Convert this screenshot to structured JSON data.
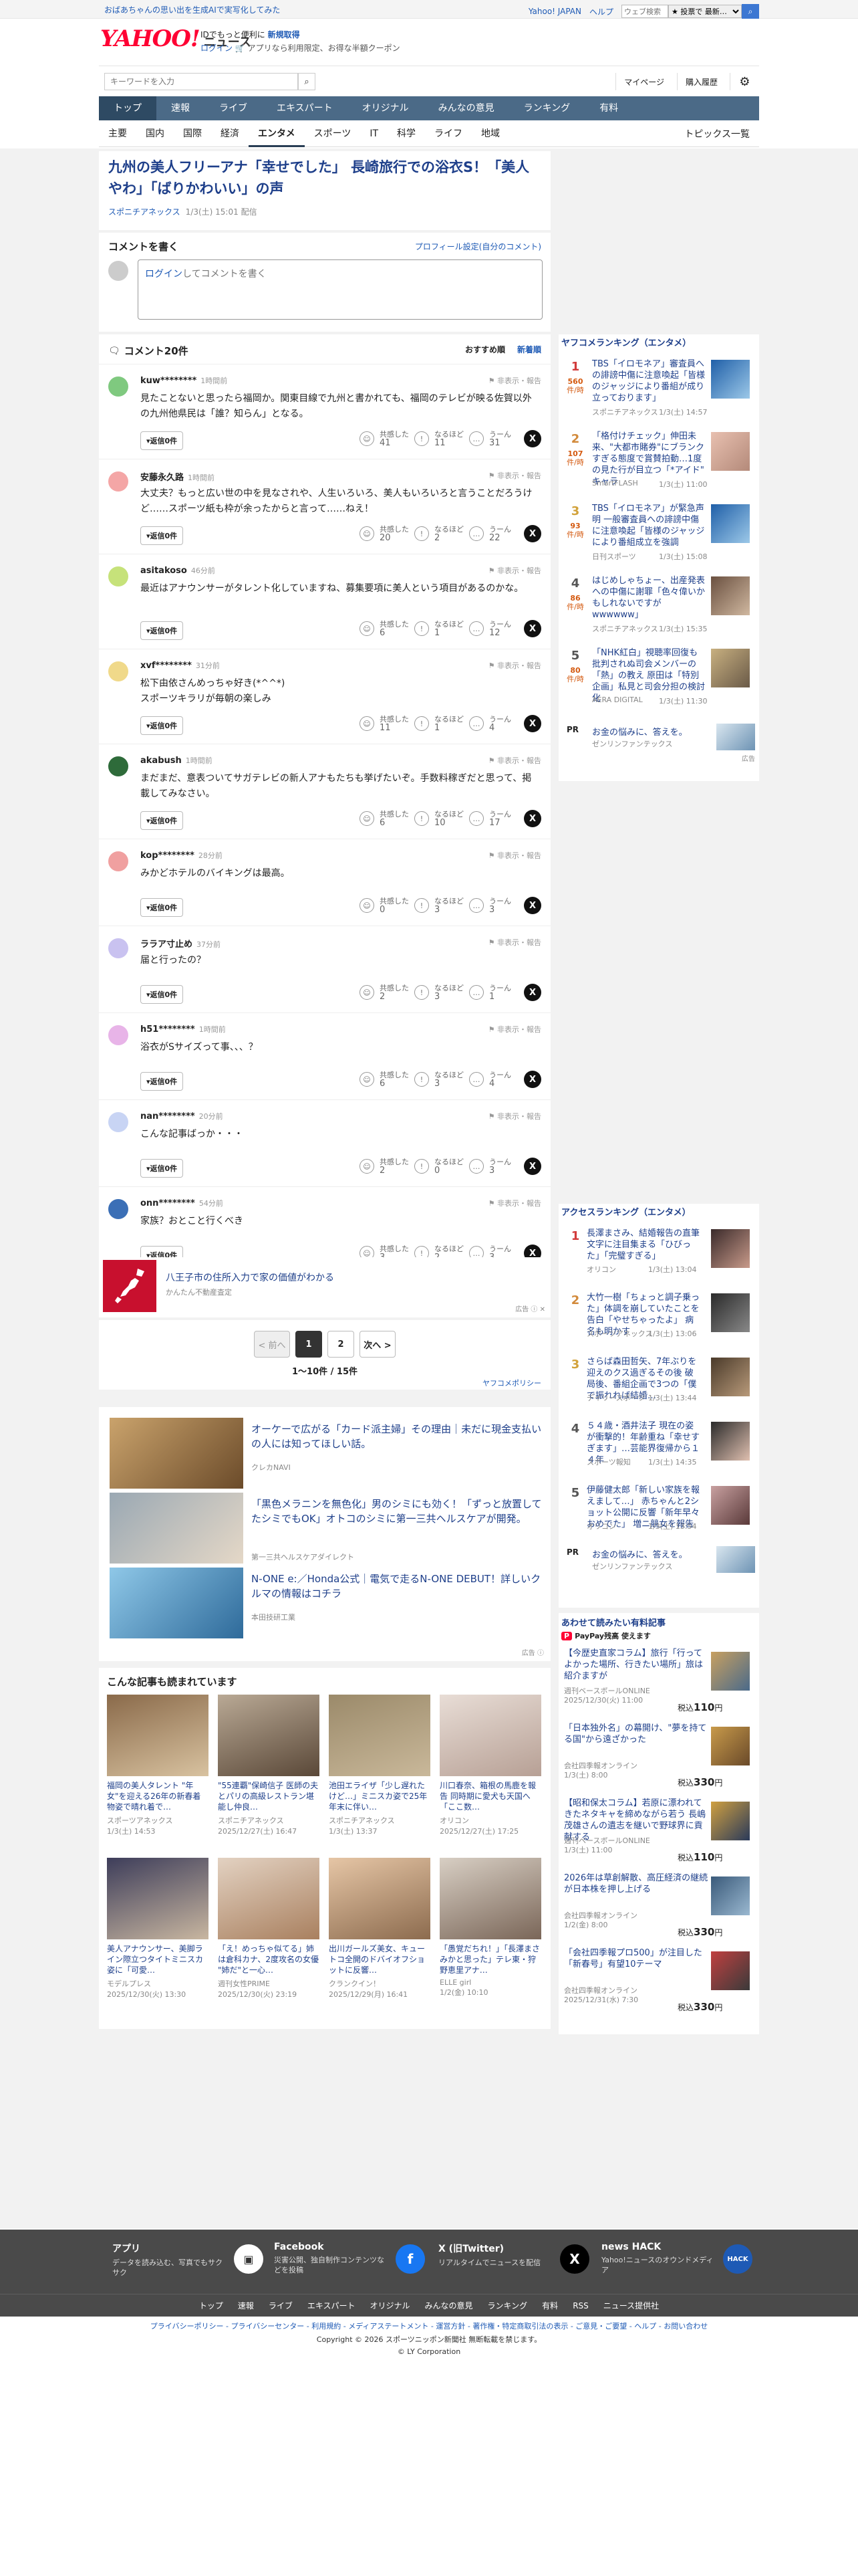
{
  "promo": "おばあちゃんの思い出を生成AIで実写化してみた",
  "toplinks": {
    "yahoo": "Yahoo! JAPAN",
    "help": "ヘルプ",
    "search_placeholder": "ウェブ検索",
    "select": "★ 投票で 最新…"
  },
  "logo": {
    "brand": "YAHOO!",
    "sub": "ニュース"
  },
  "header": {
    "line1": "IDでもっと便利に",
    "line1b": "新規取得",
    "login": "ログイン",
    "line2": "アプリなら利用限定、お得な半額クーポン"
  },
  "search": {
    "placeholder": "キーワードを入力",
    "mypage": "マイページ",
    "history": "購入履歴"
  },
  "gnav": [
    "トップ",
    "速報",
    "ライブ",
    "エキスパート",
    "オリジナル",
    "みんなの意見",
    "ランキング",
    "有料"
  ],
  "snav": [
    "主要",
    "国内",
    "国際",
    "経済",
    "エンタメ",
    "スポーツ",
    "IT",
    "科学",
    "ライフ",
    "地域"
  ],
  "snav_right": "トピックス一覧",
  "article": {
    "title": "九州の美人フリーアナ「幸せでした」 長崎旅行での浴衣S！「美人やわ」「ばりかわいい」の声",
    "source": "スポニチアネックス",
    "date": "1/3(土) 15:01",
    "status": "配信"
  },
  "comment_form": {
    "heading": "コメントを書く",
    "profile_link": "プロフィール設定(自分のコメント)",
    "placeholder_login": "ログイン",
    "placeholder_rest": "してコメントを書く"
  },
  "comments_head": {
    "title": "コメント20件",
    "sort1": "おすすめ順",
    "sort2": "新着順"
  },
  "reaction_labels": {
    "agree": "共感した",
    "learn": "なるほど",
    "hmm": "うーん",
    "report": "非表示・報告",
    "reply": "返信0件"
  },
  "comments": [
    {
      "user": "kuw********",
      "time": "1時間前",
      "text": "見たことないと思ったら福岡か。関東目線で九州と書かれても、福岡のテレビが映る佐賀以外の九州他県民は「誰？知らん」となる。",
      "r": [
        "41",
        "11",
        "31"
      ],
      "color": "#7fc97f"
    },
    {
      "user": "安藤永久路",
      "time": "1時間前",
      "text": "大丈夫？もっと広い世の中を見なされや、人生いろいろ、美人もいろいろと言うことだろうけど……スポーツ紙も枠が余ったからと言って……ねえ！",
      "r": [
        "20",
        "2",
        "22"
      ],
      "color": "#f4a6a6"
    },
    {
      "user": "asitakoso",
      "time": "46分前",
      "text": "最近はアナウンサーがタレント化していますね、募集要項に美人という項目があるのかな。",
      "r": [
        "6",
        "1",
        "12"
      ],
      "color": "#c6e27a"
    },
    {
      "user": "xvf********",
      "time": "31分前",
      "text": "松下由依さんめっちゃ好き(*^^*)\nスポーツキラリが毎朝の楽しみ",
      "r": [
        "11",
        "1",
        "4"
      ],
      "color": "#f0d98a"
    },
    {
      "user": "akabush",
      "time": "1時間前",
      "text": "まだまだ、意表ついてサガテレビの新人アナもたちも挙げたいぞ。手数料稼ぎだと思って、掲載してみなさい。",
      "r": [
        "6",
        "10",
        "17"
      ],
      "color": "#2e6b3a"
    },
    {
      "user": "kop********",
      "time": "28分前",
      "text": "みかどホテルのバイキングは最高。",
      "r": [
        "0",
        "3",
        "3"
      ],
      "color": "#f0a0a0"
    },
    {
      "user": "ララア寸止め",
      "time": "37分前",
      "text": "届と行ったの？",
      "r": [
        "2",
        "3",
        "1"
      ],
      "color": "#c9c2f0"
    },
    {
      "user": "h51********",
      "time": "1時間前",
      "text": "浴衣がSサイズって事、、、？",
      "r": [
        "6",
        "3",
        "4"
      ],
      "color": "#e8b4e8"
    },
    {
      "user": "nan********",
      "time": "20分前",
      "text": "こんな記事ばっか・・・",
      "r": [
        "2",
        "0",
        "3"
      ],
      "color": "#c8d4f4"
    },
    {
      "user": "onn********",
      "time": "54分前",
      "text": "家族？おとこと行くべき",
      "r": [
        "3",
        "2",
        "3"
      ],
      "color": "#3b6fb6"
    }
  ],
  "ad1": {
    "title": "八王子市の住所入力で家の価値がわかる",
    "sponsor": "かんたん不動産査定",
    "label": "広告"
  },
  "pager": {
    "prev": "< 前へ",
    "p1": "1",
    "p2": "2",
    "next": "次へ >",
    "count": "1〜10件 / 15件"
  },
  "policy": "ヤフコメポリシー",
  "ads": [
    {
      "title": "オーケーで広がる「カード派主婦」その理由｜未だに現金支払いの人には知ってほしい話。",
      "sponsor": "クレカNAVI"
    },
    {
      "title": "「黒色メラニンを無色化」男のシミにも効く！「ずっと放置してたシミでもOK」オトコのシミに第一三共ヘルスケアが開発。",
      "sponsor": "第一三共ヘルスケアダイレクト"
    },
    {
      "title": "N-ONE e:／Honda公式｜電気で走るN-ONE DEBUT！詳しいクルマの情報はコチラ",
      "sponsor": "本田技研工業"
    }
  ],
  "ad_label": "広告",
  "also_read": {
    "heading": "こんな記事も読まれています",
    "items": [
      {
        "t": "福岡の美人タレント \"年女\"を迎える26年の新春着物姿で晴れ着で…",
        "s": "スポーツアネックス",
        "d": "1/3(土) 14:53"
      },
      {
        "t": "\"55連覇\"保崎信子 医師の夫とパリの高級レストラン堪能し仲良…",
        "s": "スポニチアネックス",
        "d": "2025/12/27(土) 16:47"
      },
      {
        "t": "池田エライザ「少し遅れたけど…」ミニスカ姿で25年年末に伴い…",
        "s": "スポニチアネックス",
        "d": "1/3(土) 13:37"
      },
      {
        "t": "川口春奈、箱根の馬鹿を報告 同時期に愛犬も天国へ「ここ数…",
        "s": "オリコン",
        "d": "2025/12/27(土) 17:25"
      },
      {
        "t": "美人アナウンサー、美脚ライン際立つタイトミニスカ姿に「可愛…",
        "s": "モデルプレス",
        "d": "2025/12/30(火) 13:30"
      },
      {
        "t": "「え！めっちゃ似てる」姉は倉科カナ、2度攻名の女優 \"姉だ\"と一心…",
        "s": "週刊女性PRIME",
        "d": "2025/12/30(火) 23:19"
      },
      {
        "t": "出川ガールズ美女、キュートコ全開のドバイオフショットに反響…",
        "s": "クランクイン！",
        "d": "2025/12/29(月) 16:41"
      },
      {
        "t": "「愚覚だちれ！」「長澤まさみかと思った」テレ東・狩野恵里アナ…",
        "s": "ELLE girl",
        "d": "1/2(金) 10:10"
      }
    ]
  },
  "ranking": {
    "heading": "ヤフコメランキング（エンタメ）",
    "items": [
      {
        "no": "1",
        "pv": "560",
        "pvl": "件/時",
        "t": "TBS「イロモネア」審査員への誹謗中傷に注意喚起「皆様のジャッジにより番組が成り立っております」",
        "s": "スポニチアネックス",
        "d": "1/3(土) 14:57",
        "c": "#d23b3b"
      },
      {
        "no": "2",
        "pv": "107",
        "pvl": "件/時",
        "t": "「格付けチェック」伸田未来、\"大都市賭券\"にブランクすぎる態度で賞賛拍動…1度の見た行が目立つ「*アイド\" キャラ",
        "s": "SmartFLASH",
        "d": "1/3(土) 11:00",
        "c": "#d28a3b"
      },
      {
        "no": "3",
        "pv": "93",
        "pvl": "件/時",
        "t": "TBS「イロモネア」が緊急声明 一般審査員への誹謗中傷に注意喚起「皆様のジャッジにより番組成立を強調",
        "s": "日刊スポーツ",
        "d": "1/3(土) 15:08",
        "c": "#d2a23b"
      },
      {
        "no": "4",
        "pv": "86",
        "pvl": "件/時",
        "t": "はじめしゃちょー、出産発表への中傷に謝罪「色々偉いかもしれないですがwwwwww」",
        "s": "スポニチアネックス",
        "d": "1/3(土) 15:35",
        "c": "#555"
      },
      {
        "no": "5",
        "pv": "80",
        "pvl": "件/時",
        "t": "「NHK紅白」視聴率回復も批判されぬ司会メンバーの「熱」の教え 原田は「特別企画」私見と司会分担の検討化",
        "s": "AERA DIGITAL",
        "d": "1/3(土) 11:30",
        "c": "#555"
      }
    ],
    "pr": {
      "label": "PR",
      "t": "お金の悩みに、答えを。",
      "s": "ゼンリンファンテックス"
    },
    "ad_label": "広告"
  },
  "access": {
    "heading": "アクセスランキング（エンタメ）",
    "items": [
      {
        "no": "1",
        "t": "長澤まさみ、結婚報告の直筆文字に注目集まる「ひびった」「完璧すぎる」",
        "s": "オリコン",
        "d": "1/3(土) 13:04",
        "c": "#d23b3b"
      },
      {
        "no": "2",
        "t": "大竹一樹「ちょっと調子乗った」体調を崩していたことを告白「やせちゃったよ」 病名も明かす",
        "s": "スポーツアネックス",
        "d": "1/3(土) 13:06",
        "c": "#d28a3b"
      },
      {
        "no": "3",
        "t": "さらば森田哲矢、7年ぶりを迎えのクス過ぎるその後 破局後、番組企画で3つの「僕で振れれば結婚…",
        "s": "デイリースポーツ",
        "d": "1/3(土) 13:44",
        "c": "#d2a23b"
      },
      {
        "no": "4",
        "t": "５４歳・酒井法子 現在の姿が衝撃的！年齢重ね「幸せすぎます」…芸能界復帰から１４年",
        "s": "スポーツ報知",
        "d": "1/3(土) 14:35",
        "c": "#555"
      },
      {
        "no": "5",
        "t": "伊藤健太郎「新しい家族を報えまして…」 赤ちゃんと2ショット公開に反響「新年早々おめでた」 増ニ競女を報告",
        "s": "オリコン",
        "d": "1/3(土) 13:54",
        "c": "#555"
      }
    ],
    "pr": {
      "label": "PR",
      "t": "お金の悩みに、答えを。",
      "s": "ゼンリンファンテックス"
    }
  },
  "paid": {
    "heading": "あわせて読みたい有料記事",
    "badge": "PayPay残高 使えます",
    "items": [
      {
        "t": "【今歴史直家コラム】旅行「行ってよかった場所、行きたい場所」旅は紹介ますが",
        "s": "週刊ベースボールONLINE",
        "d": "2025/12/30(火) 11:00",
        "p": "110"
      },
      {
        "t": "「日本独外名」の幕開け、\"夢を持てる国\"から遠ざかった",
        "s": "会社四季報オンライン",
        "d": "1/3(土) 8:00",
        "p": "330"
      },
      {
        "t": "【昭和保太コラム】若原に漂われてきたネタキャを締めながら若う 長嶋茂雄さんの遺志を継いで野球界に貢献する",
        "s": "週刊ベースボールONLINE",
        "d": "1/3(土) 11:00",
        "p": "110"
      },
      {
        "t": "2026年は草創解散、高圧経済の継続が日本株を押し上げる",
        "s": "会社四季報オンライン",
        "d": "1/2(金) 8:00",
        "p": "330"
      },
      {
        "t": "「会社四季報プロ500」が注目した「新春号」有望10テーマ",
        "s": "会社四季報オンライン",
        "d": "2025/12/31(水) 7:30",
        "p": "330"
      }
    ],
    "yen": "円",
    "pre": "税込"
  },
  "footer": {
    "blocks": [
      {
        "t": "アプリ",
        "s": "データを読み込む、写真でもサクサク",
        "i": "▣"
      },
      {
        "t": "Facebook",
        "s": "災害公開、独自制作コンテンツなどを投稿",
        "i": "f"
      },
      {
        "t": "X (旧Twitter)",
        "s": "リアルタイムでニュースを配信",
        "i": "X"
      },
      {
        "t": "news HACK",
        "s": "Yahoo!ニュースのオウンドメディア",
        "i": "HACK"
      }
    ],
    "nav": [
      "トップ",
      "速報",
      "ライブ",
      "エキスパート",
      "オリジナル",
      "みんなの意見",
      "ランキング",
      "有料",
      "RSS",
      "ニュース提供社"
    ],
    "legal": "プライバシーポリシー - プライバシーセンター - 利用規約 - メディアステートメント - 運営方針 - 著作権・特定商取引法の表示 - ご意見・ご要望 - ヘルプ - お問い合わせ",
    "copyright": "Copyright © 2026 スポーツニッポン新聞社 無断転載を禁じます。",
    "corp": "© LY Corporation"
  }
}
